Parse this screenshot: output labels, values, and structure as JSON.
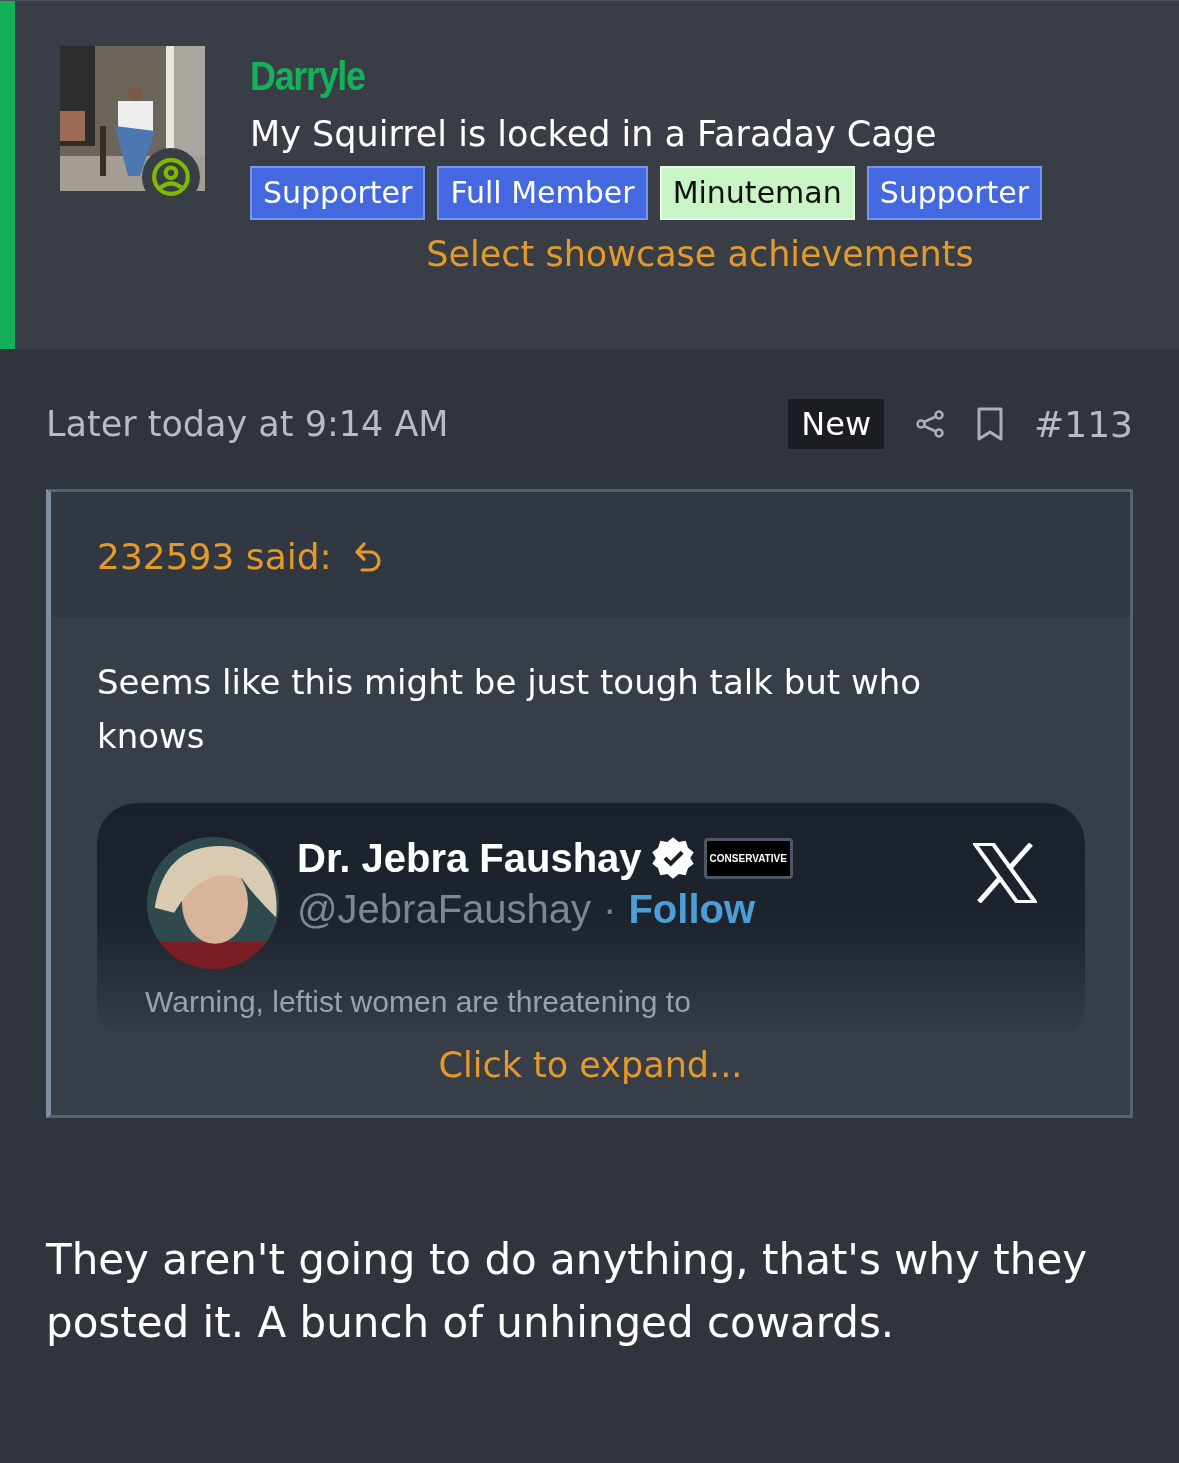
{
  "profile": {
    "username": "Darryle",
    "user_title": "My Squirrel is locked in a Faraday Cage",
    "online": true,
    "banners": [
      {
        "label": "Supporter",
        "kind": "blue"
      },
      {
        "label": "Full Member",
        "kind": "blue"
      },
      {
        "label": "Minuteman",
        "kind": "green"
      },
      {
        "label": "Supporter",
        "kind": "blue"
      }
    ],
    "showcase_link": "Select showcase achievements"
  },
  "post": {
    "date": "Later today at 9:14 AM",
    "is_new": true,
    "new_label": "New",
    "number": "#113",
    "quote": {
      "author": "232593 said:",
      "text": "Seems like this might be just tough talk but who knows",
      "embed": {
        "name": "Dr. Jebra Faushay",
        "verified": true,
        "affiliate_badge": "CONSERVATIVE",
        "handle": "@JebraFaushay",
        "separator": "·",
        "follow": "Follow",
        "preview": "Warning, leftist women are threatening to"
      },
      "expand": "Click to expand..."
    },
    "body": "They aren't going to do anything, that's why they posted it. A bunch of unhinged cowards."
  }
}
